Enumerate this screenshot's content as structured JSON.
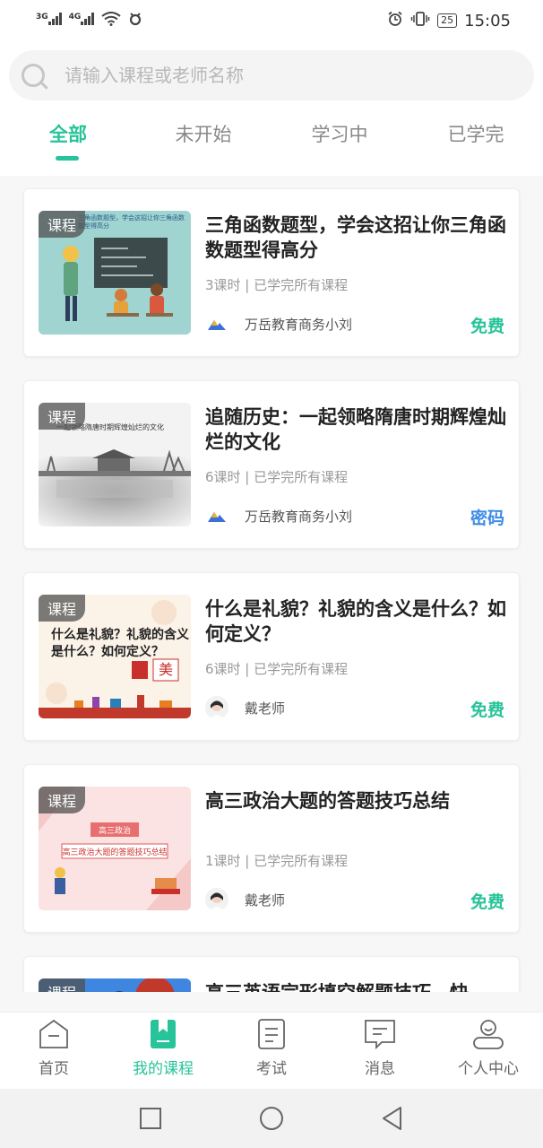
{
  "status_bar": {
    "signal1": "3G",
    "signal2": "4G",
    "battery": "25",
    "time": "15:05"
  },
  "search": {
    "placeholder": "请输入课程或老师名称"
  },
  "tabs": [
    {
      "label": "全部",
      "active": true
    },
    {
      "label": "未开始",
      "active": false
    },
    {
      "label": "学习中",
      "active": false
    },
    {
      "label": "已学完",
      "active": false
    }
  ],
  "courses": [
    {
      "tag": "课程",
      "title": "三角函数题型，学会这招让你三角函数题型得高分",
      "meta": "3课时 | 已学完所有课程",
      "author": "万岳教育商务小刘",
      "price": "免费",
      "price_type": "free",
      "thumb_caption": "三角函数题型，学会这招让你三角函数题型得高分"
    },
    {
      "tag": "课程",
      "title": "追随历史：一起领略隋唐时期辉煌灿烂的文化",
      "meta": "6课时 | 已学完所有课程",
      "author": "万岳教育商务小刘",
      "price": "密码",
      "price_type": "password",
      "thumb_caption": "一起领略隋唐时期辉煌灿烂的文化"
    },
    {
      "tag": "课程",
      "title": "什么是礼貌？礼貌的含义是什么？如何定义？",
      "meta": "6课时 | 已学完所有课程",
      "author": "戴老师",
      "price": "免费",
      "price_type": "free",
      "thumb_caption": "什么是礼貌？礼貌的含义是什么？如何定义？",
      "thumb_seal": "美"
    },
    {
      "tag": "课程",
      "title": "高三政治大题的答题技巧总结",
      "meta": "1课时 | 已学完所有课程",
      "author": "戴老师",
      "price": "免费",
      "price_type": "free",
      "thumb_caption_top": "高三政治",
      "thumb_caption": "高三政治大题的答题技巧总结"
    },
    {
      "tag": "课程",
      "title": "高三英语完形填空解题技巧，快"
    }
  ],
  "bottom_nav": [
    {
      "label": "首页",
      "icon": "home-icon",
      "active": false
    },
    {
      "label": "我的课程",
      "icon": "bookmark-icon",
      "active": true
    },
    {
      "label": "考试",
      "icon": "exam-icon",
      "active": false
    },
    {
      "label": "消息",
      "icon": "message-icon",
      "active": false
    },
    {
      "label": "个人中心",
      "icon": "profile-icon",
      "active": false
    }
  ],
  "colors": {
    "accent": "#27c39a",
    "password": "#3d8be5"
  }
}
